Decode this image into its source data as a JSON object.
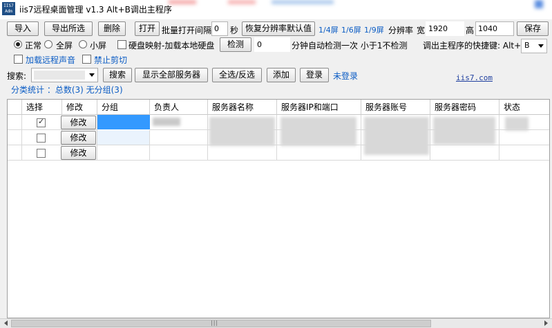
{
  "window": {
    "title": "iis7远程桌面管理 v1.3 Alt+B调出主程序",
    "icon_text": "IIS7\nAdm"
  },
  "toolbar": {
    "import": "导入",
    "export_selected": "导出所选",
    "delete": "删除",
    "open": "打开",
    "batch_interval_label": "批量打开间隔",
    "batch_interval_value": "0",
    "seconds": "秒",
    "restore_resolution": "恢复分辨率默认值",
    "split_4": "1/4屏",
    "split_6": "1/6屏",
    "split_9": "1/9屏",
    "resolution_label": "分辨率",
    "width_label": "宽",
    "width_value": "1920",
    "height_label": "高",
    "height_value": "1040",
    "save": "保存"
  },
  "options": {
    "normal": "正常",
    "fullscreen": "全屏",
    "small": "小屏",
    "disk_map": "硬盘映射-加载本地硬盘",
    "detect": "检测",
    "detect_value": "0",
    "detect_note": "分钟自动检测一次 小于1不检测",
    "hotkey_label": "调出主程序的快捷键: Alt+",
    "hotkey_value": "B",
    "remote_sound": "加载远程声音",
    "no_clipboard": "禁止剪切"
  },
  "searchbar": {
    "label": "搜索:",
    "search": "搜索",
    "show_all": "显示全部服务器",
    "select_all": "全选/反选",
    "add": "添加",
    "login": "登录",
    "login_status": "未登录",
    "site_link": "iis7.com"
  },
  "stats": {
    "text": "分类统计 ：总数(3) 无分组(3)"
  },
  "table": {
    "columns": [
      "选择",
      "修改",
      "分组",
      "负责人",
      "服务器名称",
      "服务器IP和端口",
      "服务器账号",
      "服务器密码",
      "状态"
    ],
    "edit_label": "修改",
    "rows": [
      {
        "checked": true
      },
      {
        "checked": false
      },
      {
        "checked": false
      }
    ]
  }
}
